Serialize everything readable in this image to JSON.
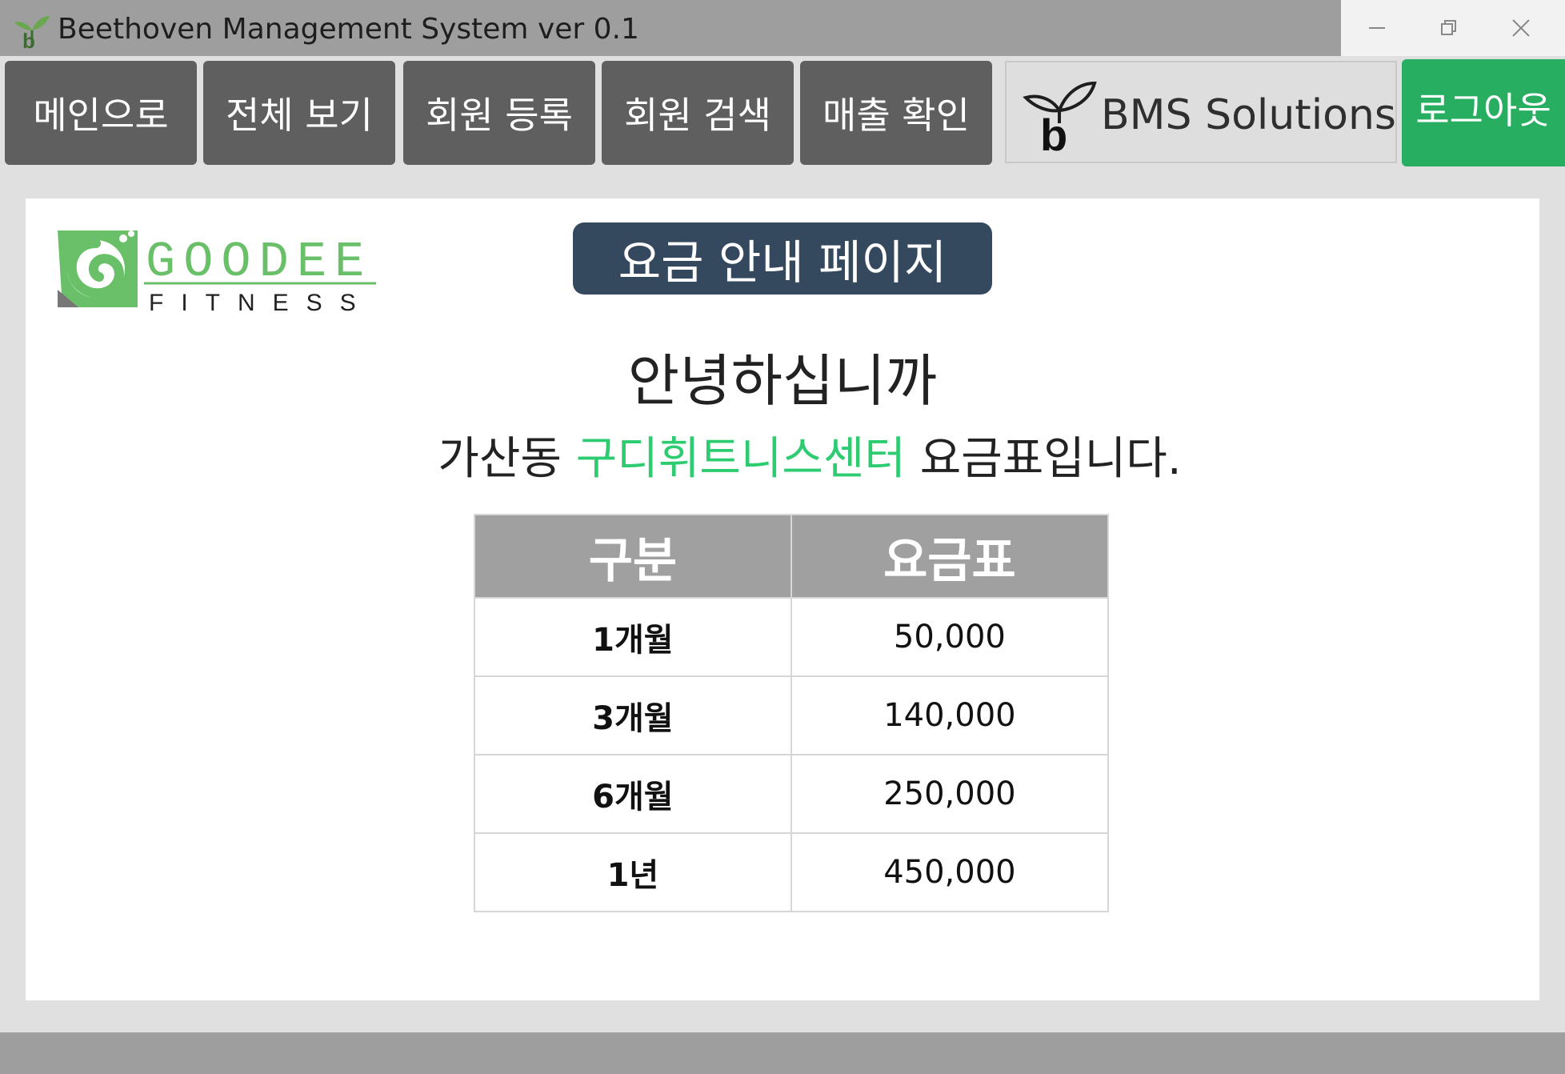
{
  "window": {
    "title": "Beethoven Management System ver 0.1",
    "app_icon": "sprout-b-icon",
    "controls": [
      "minimize-icon",
      "restore-icon",
      "close-icon"
    ]
  },
  "nav": {
    "buttons": [
      {
        "label": "메인으로"
      },
      {
        "label": "전체 보기"
      },
      {
        "label": "회원 등록"
      },
      {
        "label": "회원 검색"
      },
      {
        "label": "매출 확인"
      }
    ],
    "brand": {
      "name": "BMS Solutions",
      "icon": "sprout-b-logo"
    },
    "logout_label": "로그아웃"
  },
  "main": {
    "logo": {
      "word1": "GOODEE",
      "word2": "FITNESS",
      "icon": "goodee-fitness-logo"
    },
    "page_title": "요금 안내 페이지",
    "greeting": "안녕하십니까",
    "subline": {
      "prefix": "가산동 ",
      "highlight": "구디휘트니스센터",
      "suffix": " 요금표입니다."
    },
    "table": {
      "headers": [
        "구분",
        "요금표"
      ],
      "rows": [
        {
          "period": "1개월",
          "price": "50,000"
        },
        {
          "period": "3개월",
          "price": "140,000"
        },
        {
          "period": "6개월",
          "price": "250,000"
        },
        {
          "period": "1년",
          "price": "450,000"
        }
      ]
    }
  },
  "colors": {
    "titlebar": "#9e9e9e",
    "nav_button": "#5f5f5f",
    "logout": "#27ae60",
    "page_badge": "#34495e",
    "highlight": "#2ecc71",
    "table_header": "#a0a0a0"
  }
}
